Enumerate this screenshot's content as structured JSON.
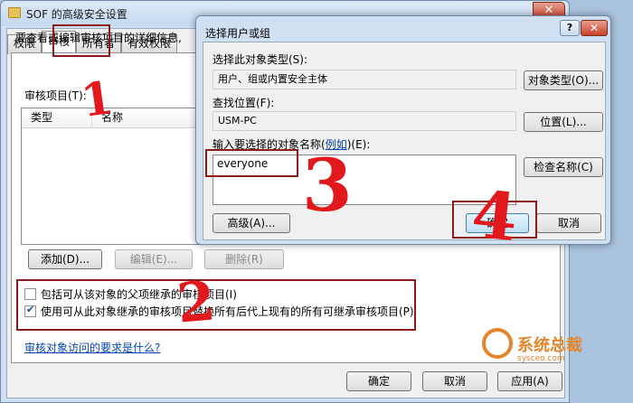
{
  "main_window": {
    "title": "SOF 的高级安全设置",
    "close_label": "✕",
    "tabs": [
      "权限",
      "审核",
      "所有者",
      "有效权限"
    ],
    "description": "要查看或编辑审核项目的详细信息,",
    "list_label": "审核项目(T):",
    "columns": [
      "类型",
      "名称"
    ],
    "buttons": {
      "add": "添加(D)...",
      "edit": "编辑(E)...",
      "remove": "删除(R)"
    },
    "checkbox1": "包括可从该对象的父项继承的审核项目(I)",
    "checkbox2": "使用可从此对象继承的审核项目替换所有后代上现有的所有可继承审核项目(P)",
    "link": "审核对象访问的要求是什么?",
    "ok": "确定",
    "cancel": "取消",
    "apply": "应用(A)"
  },
  "dialog": {
    "title": "选择用户或组",
    "help_label": "?",
    "close_label": "✕",
    "object_type_label": "选择此对象类型(S):",
    "object_type_value": "用户、组或内置安全主体",
    "object_type_button": "对象类型(O)...",
    "location_label": "查找位置(F):",
    "location_value": "USM-PC",
    "location_button": "位置(L)...",
    "name_label_prefix": "输入要选择的对象名称(",
    "name_label_link": "例如",
    "name_label_suffix": ")(E):",
    "name_value": "everyone",
    "check_names_button": "检查名称(C)",
    "advanced_button": "高级(A)...",
    "ok_button": "确定",
    "cancel_button": "取消"
  },
  "annotations": [
    "1",
    "2",
    "3",
    "4"
  ],
  "watermark": {
    "brand": "系统总裁",
    "sub": "sysceo.com"
  },
  "colors": {
    "annotation_box": "#8b1a1a",
    "annotation_number": "#e2191c",
    "link": "#0645ad"
  }
}
